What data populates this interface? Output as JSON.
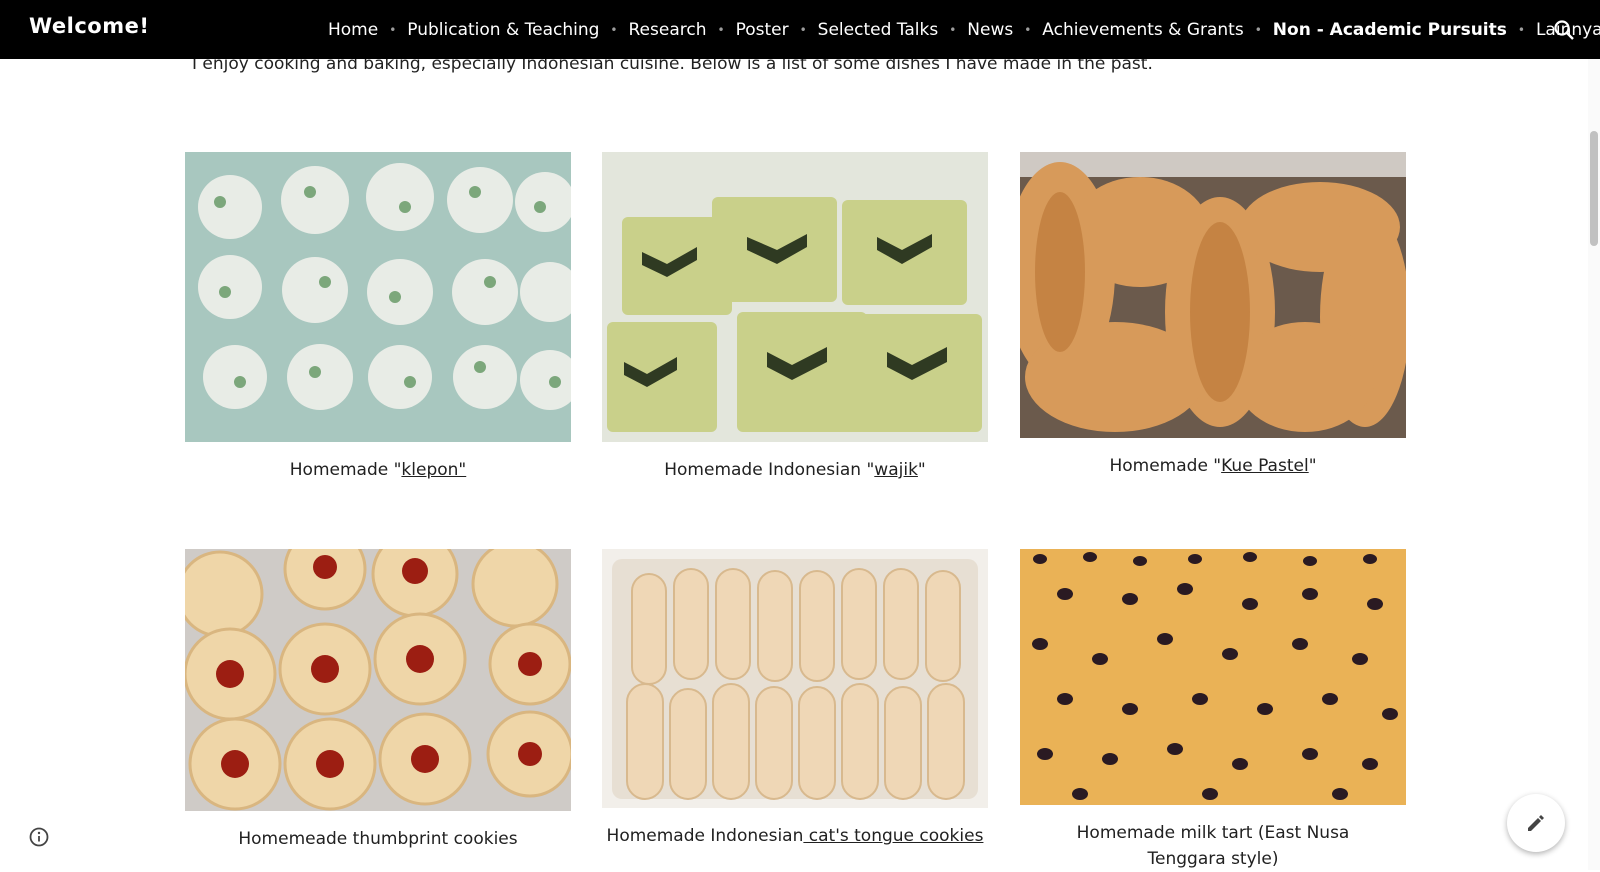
{
  "header": {
    "site_title": "Welcome!",
    "nav": [
      {
        "label": "Home"
      },
      {
        "label": "Publication & Teaching"
      },
      {
        "label": "Research"
      },
      {
        "label": "Poster"
      },
      {
        "label": "Selected Talks"
      },
      {
        "label": "News"
      },
      {
        "label": "Achievements & Grants"
      },
      {
        "label": "Non - Academic Pursuits",
        "active": true
      },
      {
        "label": "Lainnya"
      }
    ],
    "search_icon": "search-icon",
    "more_icon": "chevron-down-icon"
  },
  "main": {
    "intro": "I enjoy cooking and baking, especially Indonesian cuisine. Below is a list of some dishes I have made in the past.",
    "dishes": [
      {
        "prefix": "Homemade \"",
        "link": "klepon\"",
        "suffix": ""
      },
      {
        "prefix": "Homemade Indonesian \"",
        "link": "wajik",
        "suffix": "\""
      },
      {
        "prefix": "Homemade \"",
        "link": "Kue Pastel",
        "suffix": "\""
      },
      {
        "prefix": "Homemeade thumbprint cookies",
        "link": "",
        "suffix": ""
      },
      {
        "prefix": "Homemade Indonesian",
        "link": " cat's tongue cookies",
        "suffix": ""
      },
      {
        "prefix": "Homemade milk tart (East Nusa Tenggara style)",
        "link": "",
        "suffix": ""
      }
    ]
  },
  "footer": {
    "info_icon": "info-icon",
    "edit_icon": "pencil-icon"
  }
}
